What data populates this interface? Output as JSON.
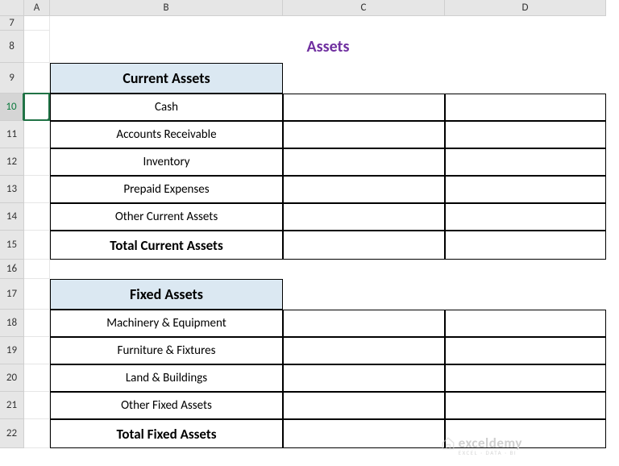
{
  "columns": [
    "",
    "A",
    "B",
    "C",
    "D"
  ],
  "rows": [
    "7",
    "8",
    "9",
    "10",
    "11",
    "12",
    "13",
    "14",
    "15",
    "16",
    "17",
    "18",
    "19",
    "20",
    "21",
    "22"
  ],
  "selected_row": "10",
  "title": "Assets",
  "section1": {
    "header": "Current Assets",
    "items": [
      "Cash",
      "Accounts Receivable",
      "Inventory",
      "Prepaid Expenses",
      "Other Current Assets"
    ],
    "total_label": "Total Current Assets"
  },
  "section2": {
    "header": "Fixed Assets",
    "items": [
      "Machinery & Equipment",
      "Furniture & Fixtures",
      "Land & Buildings",
      "Other Fixed Assets"
    ],
    "total_label": "Total Fixed Assets"
  },
  "watermark": {
    "brand": "exceldemy",
    "tagline": "EXCEL · DATA · BI"
  }
}
